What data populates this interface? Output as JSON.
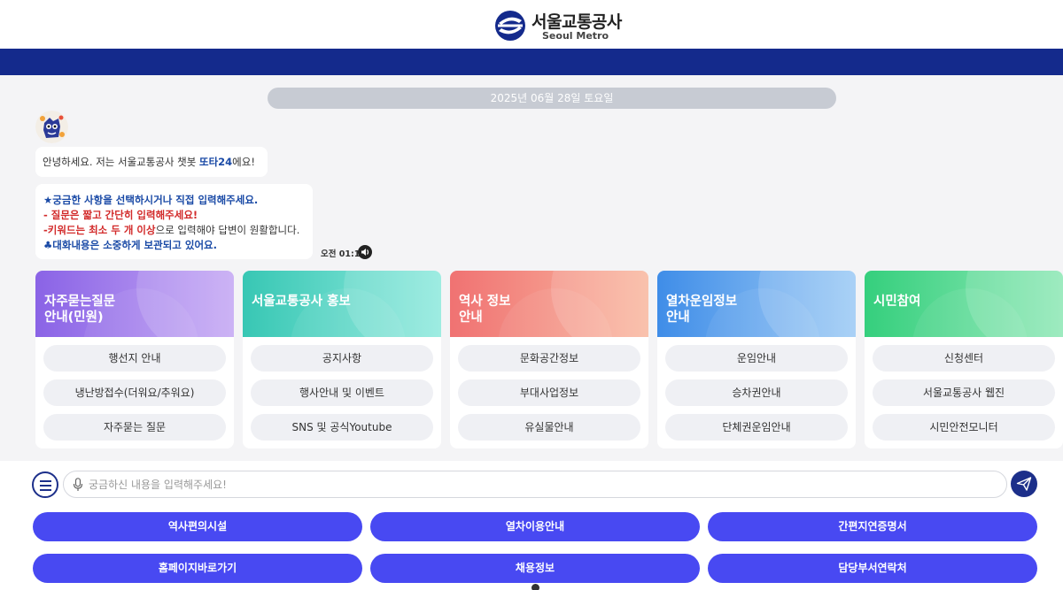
{
  "header": {
    "logo_ko": "서울교통공사",
    "logo_en": "Seoul Metro",
    "brand_color": "#142a8c"
  },
  "chat": {
    "date": "2025년 06월 28일 토요일",
    "greeting_pre": "안녕하세요. 저는 서울교통공사 챗봇 ",
    "greeting_name": "또타24",
    "greeting_post": "에요!",
    "guide_line1": "★궁금한 사항을 선택하시거나 직접 입력해주세요.",
    "guide_line2": "- 질문은 짧고 간단히 입력해주세요!",
    "guide_line3_pre": "-",
    "guide_line3_bold": "키워드는 최소 두 개 이상",
    "guide_line3_post": "으로 입력해야 답변이 원활합니다.",
    "guide_line4": "♣대화내용은 소중하게 보관되고 있어요.",
    "time": "오전 01:18",
    "speaker_icon": "speaker-icon"
  },
  "cards": [
    {
      "title_line1": "자주묻는질문",
      "title_line2": "안내(민원)",
      "items": [
        "행선지 안내",
        "냉난방접수(더워요/추워요)",
        "자주묻는 질문"
      ]
    },
    {
      "title_line1": "서울교통공사 홍보",
      "title_line2": "",
      "items": [
        "공지사항",
        "행사안내 및 이벤트",
        "SNS 및 공식Youtube"
      ]
    },
    {
      "title_line1": "역사 정보",
      "title_line2": "안내",
      "items": [
        "문화공간정보",
        "부대사업정보",
        "유실물안내"
      ]
    },
    {
      "title_line1": "열차운임정보",
      "title_line2": "안내",
      "items": [
        "운임안내",
        "승차권안내",
        "단체권운임안내"
      ]
    },
    {
      "title_line1": "시민참여",
      "title_line2": "",
      "items": [
        "신청센터",
        "서울교통공사 웹진",
        "시민안전모니터"
      ]
    }
  ],
  "input": {
    "placeholder": "궁금하신 내용을 입력해주세요!"
  },
  "quick_buttons": [
    "역사편의시설",
    "열차이용안내",
    "간편지연증명서",
    "홈페이지바로가기",
    "채용정보",
    "담당부서연락처"
  ],
  "colors": {
    "quick_button": "#4849f2",
    "accent_text": "#1a4aa6"
  }
}
